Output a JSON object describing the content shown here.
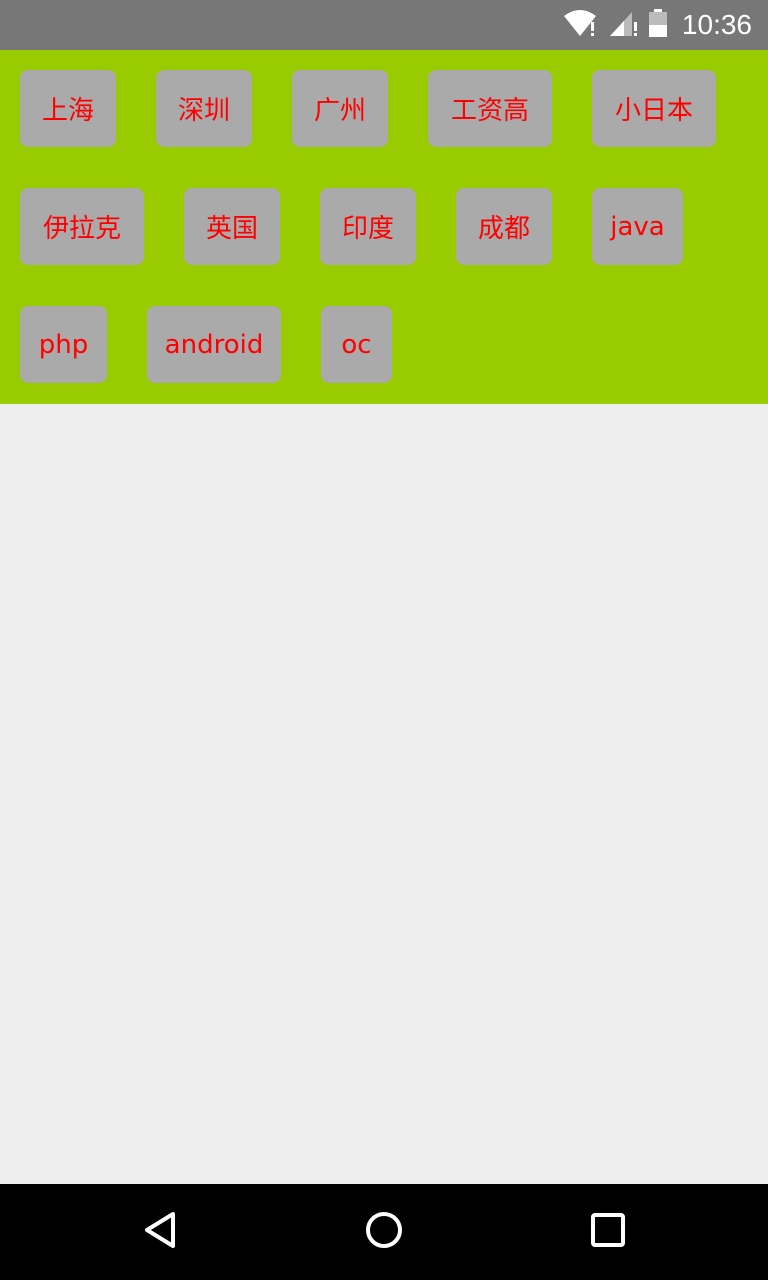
{
  "status_bar": {
    "time": "10:36",
    "icons": [
      "wifi-icon",
      "signal-icon",
      "battery-icon"
    ]
  },
  "tags": [
    "上海",
    "深圳",
    "广州",
    "工资高",
    "小日本",
    "伊拉克",
    "英国",
    "印度",
    "成都",
    "java",
    "php",
    "android",
    "oc"
  ],
  "colors": {
    "tag_area_bg": "#99cc00",
    "tag_bg": "#aaaaaa",
    "tag_text": "#ff0000",
    "status_bar_bg": "#777777",
    "nav_bar_bg": "#000000",
    "content_bg": "#eeeeee"
  },
  "nav_bar": {
    "icons": [
      "back-icon",
      "home-icon",
      "recents-icon"
    ]
  }
}
